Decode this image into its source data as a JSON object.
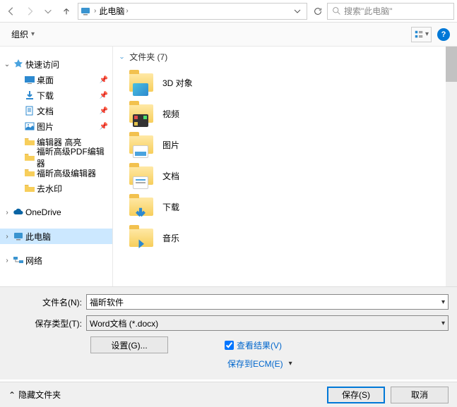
{
  "addr": {
    "location": "此电脑",
    "search_placeholder": "搜索\"此电脑\""
  },
  "toolbar": {
    "organize": "组织",
    "help": "?"
  },
  "sidebar": {
    "quick": {
      "label": "快速访问",
      "items": [
        {
          "label": "桌面",
          "pinned": true,
          "icon": "desktop"
        },
        {
          "label": "下载",
          "pinned": true,
          "icon": "download"
        },
        {
          "label": "文档",
          "pinned": true,
          "icon": "document"
        },
        {
          "label": "图片",
          "pinned": true,
          "icon": "pictures"
        },
        {
          "label": "编辑器 高亮",
          "pinned": false,
          "icon": "folder"
        },
        {
          "label": "福昕高级PDF编辑器",
          "pinned": false,
          "icon": "folder"
        },
        {
          "label": "福昕高级编辑器",
          "pinned": false,
          "icon": "folder"
        },
        {
          "label": "去水印",
          "pinned": false,
          "icon": "folder"
        }
      ]
    },
    "onedrive": "OneDrive",
    "thispc": "此电脑",
    "network": "网络"
  },
  "content": {
    "group_label": "文件夹 (7)",
    "items": [
      {
        "label": "3D 对象"
      },
      {
        "label": "视频"
      },
      {
        "label": "图片"
      },
      {
        "label": "文档"
      },
      {
        "label": "下载"
      },
      {
        "label": "音乐"
      }
    ]
  },
  "fields": {
    "filename_label": "文件名(N):",
    "filename_value": "福昕软件",
    "filetype_label": "保存类型(T):",
    "filetype_value": "Word文档 (*.docx)",
    "settings": "设置(G)...",
    "view_result": "查看结果(V)",
    "save_ecm": "保存到ECM(E)"
  },
  "footer": {
    "hide_folders": "隐藏文件夹",
    "save": "保存(S)",
    "cancel": "取消"
  }
}
